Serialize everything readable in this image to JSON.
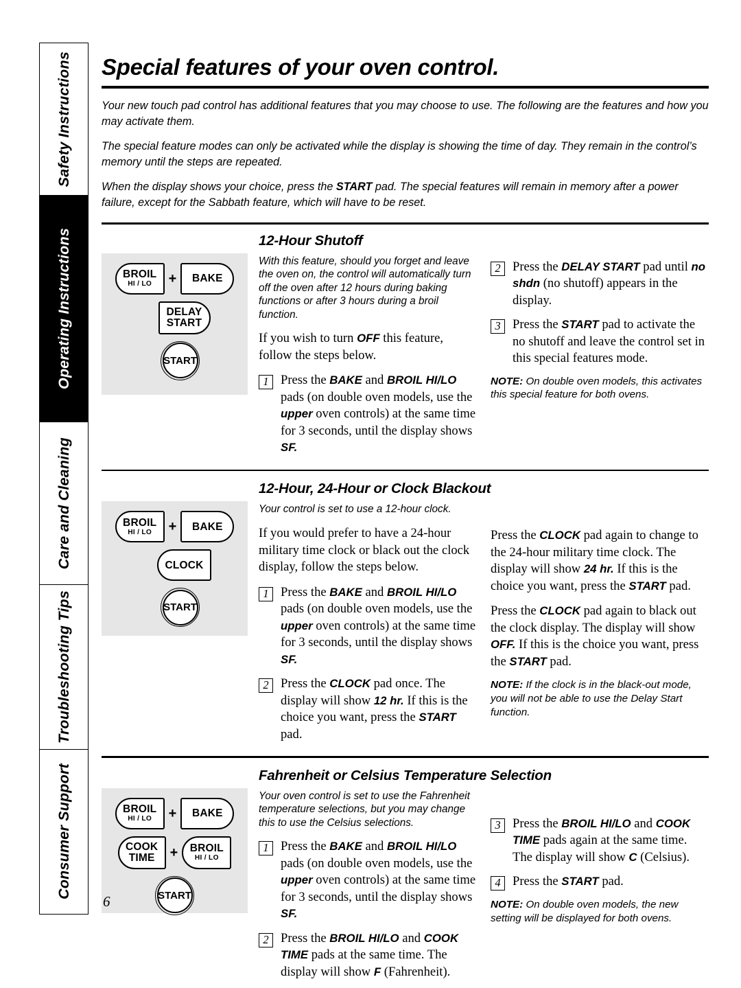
{
  "sidebar": {
    "tabs": [
      {
        "label": "Safety Instructions",
        "active": false
      },
      {
        "label": "Operating Instructions",
        "active": true
      },
      {
        "label": "Care and Cleaning",
        "active": false
      },
      {
        "label": "Troubleshooting Tips",
        "active": false
      },
      {
        "label": "Consumer Support",
        "active": false
      }
    ]
  },
  "header": {
    "title": "Special features of your oven control."
  },
  "intro": {
    "p1": "Your new touch pad control has additional features that you may choose to use. The following are the features and how you may activate them.",
    "p2": "The special feature modes can only be activated while the display is showing the time of day. They remain in the control’s memory until the steps are repeated.",
    "p3_a": "When the display shows your choice, press the ",
    "p3_b": "START",
    "p3_c": " pad. The special features will remain in memory after a power failure, except for the Sabbath feature, which will have to be reset."
  },
  "section1": {
    "heading": "12-Hour Shutoff",
    "desc": "With this feature, should you forget and leave the oven on, the control will automatically turn off the oven after 12 hours during baking functions or after 3 hours during a broil function.",
    "lead_a": "If you wish to turn ",
    "lead_b": "OFF",
    "lead_c": " this feature, follow the steps below.",
    "steps": [
      {
        "num": "1",
        "a": "Press the ",
        "b1": "BAKE",
        "c": " and ",
        "b2": "BROIL HI/LO",
        "d": " pads (on double oven models, use the ",
        "b3": "upper",
        "e": " oven controls) at the same time for 3 seconds, until the display shows ",
        "b4": "SF."
      },
      {
        "num": "2",
        "a": "Press the ",
        "b1": "DELAY START",
        "c": " pad until ",
        "b2": "no shdn",
        "d": " (no shutoff) appears in the display."
      },
      {
        "num": "3",
        "a": "Press the ",
        "b1": "START",
        "c": " pad to activate the no shutoff and leave the control set in this special features mode."
      }
    ],
    "note_label": "NOTE:",
    "note_text": " On double oven models, this activates this special feature for both ovens.",
    "keys": [
      {
        "name": "broil-hi-lo",
        "line1": "BROIL",
        "line2": "HI / LO"
      },
      {
        "name": "bake",
        "line1": "BAKE"
      },
      {
        "name": "delay-start",
        "line1": "DELAY",
        "line2": "START"
      },
      {
        "name": "start",
        "line1": "START"
      }
    ]
  },
  "section2": {
    "heading": "12-Hour, 24-Hour or Clock Blackout",
    "desc": "Your control is set to use a 12-hour clock.",
    "lead": "If you would prefer to have a 24-hour military time clock or black out the clock display, follow the steps below.",
    "steps": [
      {
        "num": "1",
        "a": "Press the ",
        "b1": "BAKE",
        "c": " and ",
        "b2": "BROIL HI/LO",
        "d": " pads (on double oven models, use the ",
        "b3": "upper",
        "e": " oven controls) at the same time for 3 seconds, until the display shows ",
        "b4": "SF."
      },
      {
        "num": "2",
        "a": "Press the ",
        "b1": "CLOCK",
        "c": " pad once. The display will show ",
        "b2": "12 hr.",
        "d": " If this is the choice you want, press the ",
        "b3": "START",
        "e": " pad."
      }
    ],
    "right_p1_a": "Press the ",
    "right_p1_b": "CLOCK",
    "right_p1_c": " pad again to change to the 24-hour military time clock. The display will show ",
    "right_p1_d": "24 hr.",
    "right_p1_e": " If this is the choice you want, press the ",
    "right_p1_f": "START",
    "right_p1_g": " pad.",
    "right_p2_a": "Press the ",
    "right_p2_b": "CLOCK",
    "right_p2_c": " pad again to black out the clock display. The display will show ",
    "right_p2_d": "OFF.",
    "right_p2_e": " If this is the choice you want, press the ",
    "right_p2_f": "START",
    "right_p2_g": " pad.",
    "note_label": "NOTE:",
    "note_text": " If the clock is in the black-out mode, you will not be able to use the Delay Start function.",
    "keys": [
      {
        "name": "broil-hi-lo",
        "line1": "BROIL",
        "line2": "HI / LO"
      },
      {
        "name": "bake",
        "line1": "BAKE"
      },
      {
        "name": "clock",
        "line1": "CLOCK"
      },
      {
        "name": "start",
        "line1": "START"
      }
    ]
  },
  "section3": {
    "heading": "Fahrenheit or Celsius Temperature Selection",
    "desc": "Your oven control is set to use the Fahrenheit temperature selections, but you may change this to use the Celsius selections.",
    "steps": [
      {
        "num": "1",
        "a": "Press the ",
        "b1": "BAKE",
        "c": " and ",
        "b2": "BROIL HI/LO",
        "d": " pads (on double oven models, use the ",
        "b3": "upper",
        "e": " oven controls) at the same time for 3 seconds, until the display shows ",
        "b4": "SF."
      },
      {
        "num": "2",
        "a": "Press the ",
        "b1": "BROIL HI/LO",
        "c": " and ",
        "b2": "COOK TIME",
        "d": " pads at the same time. The display will show ",
        "b3": "F",
        "e": " (Fahrenheit)."
      },
      {
        "num": "3",
        "a": "Press the ",
        "b1": "BROIL HI/LO",
        "c": " and ",
        "b2": "COOK TIME",
        "d": " pads again at the same time. The display will show ",
        "b3": "C",
        "e": " (Celsius)."
      },
      {
        "num": "4",
        "a": "Press the ",
        "b1": "START",
        "c": " pad."
      }
    ],
    "note_label": "NOTE:",
    "note_text": " On double oven models, the new setting will be displayed for both ovens.",
    "keys": [
      {
        "name": "broil-hi-lo",
        "line1": "BROIL",
        "line2": "HI / LO"
      },
      {
        "name": "bake",
        "line1": "BAKE"
      },
      {
        "name": "cook-time",
        "line1": "COOK",
        "line2": "TIME"
      },
      {
        "name": "broil-hi-lo-2",
        "line1": "BROIL",
        "line2": "HI / LO"
      },
      {
        "name": "start",
        "line1": "START"
      }
    ]
  },
  "footer": {
    "page_number": "6"
  },
  "symbols": {
    "plus": "+"
  }
}
